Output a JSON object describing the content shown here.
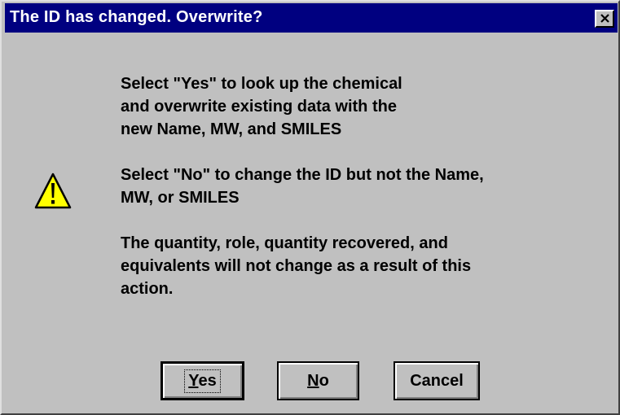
{
  "window": {
    "title": "The ID has changed.  Overwrite?",
    "close_glyph": "✕",
    "close_icon": "close-icon"
  },
  "icon": {
    "name": "warning-icon",
    "glyph": "!",
    "color": "#ffff00"
  },
  "message": {
    "paragraphs": [
      "Select \"Yes\" to look up the chemical\nand overwrite existing data with the\nnew Name, MW, and SMILES",
      "Select \"No\" to change the ID but not the Name,\nMW, or SMILES",
      "The quantity, role, quantity recovered, and\nequivalents will not change as a result of this\naction."
    ]
  },
  "buttons": {
    "yes": {
      "mnemonic": "Y",
      "rest": "es"
    },
    "no": {
      "mnemonic": "N",
      "rest": "o"
    },
    "cancel": {
      "label": "Cancel"
    }
  },
  "colors": {
    "face": "#c0c0c0",
    "titlebar": "#000080",
    "title_text": "#ffffff"
  }
}
